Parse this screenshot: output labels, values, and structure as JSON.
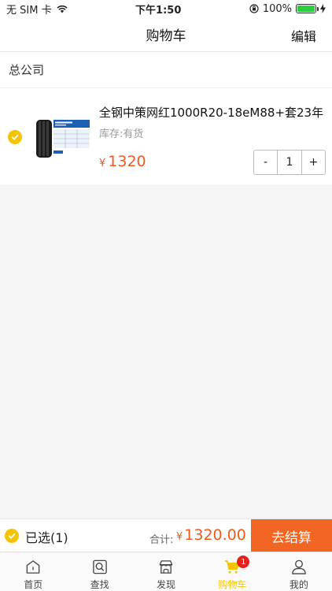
{
  "status_bar": {
    "carrier": "无 SIM 卡",
    "time": "下午1:50",
    "battery": "100%"
  },
  "nav": {
    "title": "购物车",
    "edit_label": "编辑"
  },
  "company": {
    "name": "总公司"
  },
  "cart_item": {
    "name": "全钢中策网红1000R20-18eM88+套23年",
    "stock": "库存:有货",
    "currency": "¥",
    "price": "1320",
    "quantity": "1",
    "minus": "-",
    "plus": "+",
    "selected": true
  },
  "checkout": {
    "selected_text": "已选(1)",
    "total_label": "合计:",
    "currency": "¥",
    "total": "1320.00",
    "button_label": "去结算"
  },
  "tabs": [
    {
      "label": "首页",
      "icon": "home-icon"
    },
    {
      "label": "查找",
      "icon": "search-icon"
    },
    {
      "label": "发现",
      "icon": "store-icon"
    },
    {
      "label": "购物车",
      "icon": "cart-icon",
      "badge": "1",
      "active": true
    },
    {
      "label": "我的",
      "icon": "profile-icon"
    }
  ],
  "colors": {
    "accent_yellow": "#f5c400",
    "price_orange": "#f05a1e",
    "checkout_orange": "#f26522",
    "badge_red": "#e5211c"
  }
}
